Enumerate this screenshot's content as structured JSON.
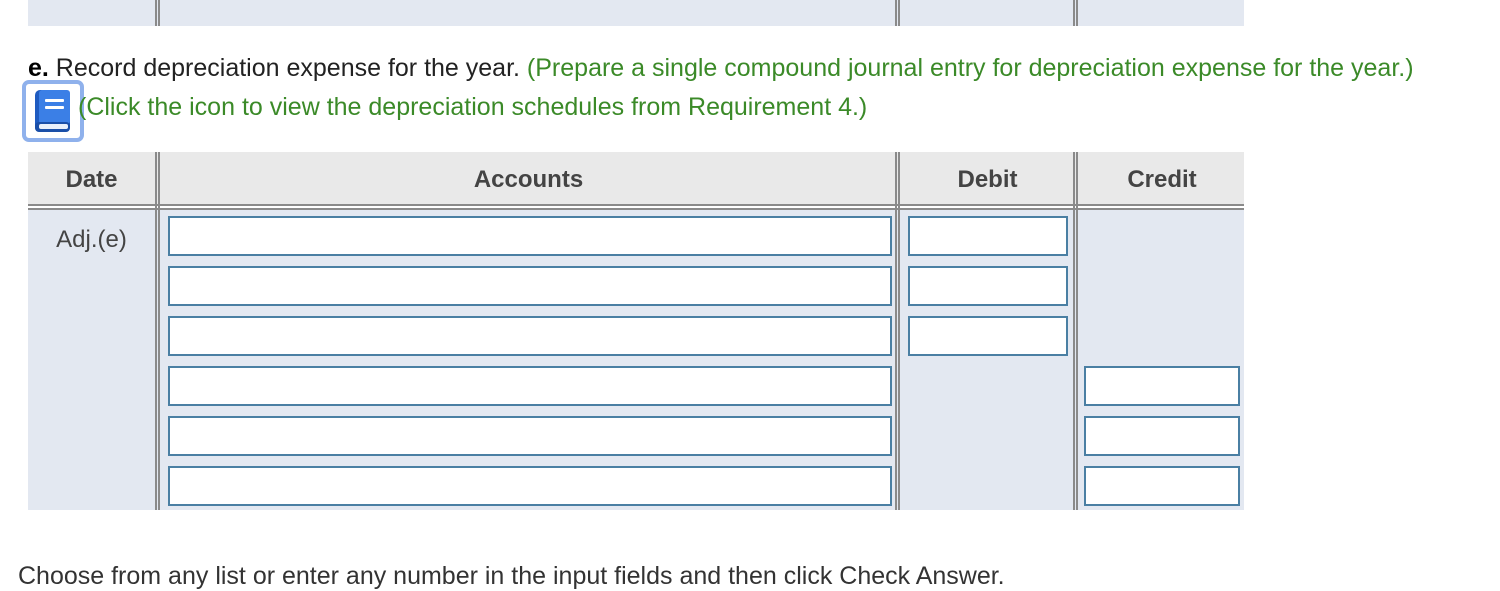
{
  "instruction": {
    "label": "e.",
    "text": " Record depreciation expense for the year.",
    "hint": " (Prepare a single compound journal entry for depreciation expense for the year.)",
    "icon_hint": "(Click the icon to view the depreciation schedules from Requirement 4.)",
    "icon": "book-icon"
  },
  "table": {
    "headers": {
      "date": "Date",
      "accounts": "Accounts",
      "debit": "Debit",
      "credit": "Credit"
    },
    "entry_label": "Adj.(e)",
    "rows": [
      {
        "account": "",
        "debit": ""
      },
      {
        "account": "",
        "debit": ""
      },
      {
        "account": "",
        "debit": ""
      },
      {
        "account": "",
        "credit": ""
      },
      {
        "account": "",
        "credit": ""
      },
      {
        "account": "",
        "credit": ""
      }
    ]
  },
  "footer_text": "Choose from any list or enter any number in the input fields and then click Check Answer.",
  "colors": {
    "hint_green": "#3b8a28",
    "table_body": "#e3e8f1",
    "table_header": "#e9e9e9",
    "input_border": "#4a7fa3",
    "icon_blue": "#2f6fd8"
  }
}
